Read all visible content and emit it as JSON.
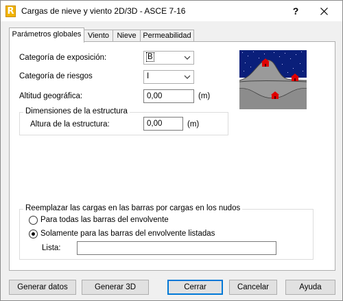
{
  "window": {
    "title": "Cargas de nieve y viento 2D/3D - ASCE 7-16",
    "help_label": "?"
  },
  "tabs": [
    {
      "label": "Parámetros globales",
      "active": true
    },
    {
      "label": "Viento",
      "active": false
    },
    {
      "label": "Nieve",
      "active": false
    },
    {
      "label": "Permeabilidad",
      "active": false
    }
  ],
  "form": {
    "exposure_label": "Categoría de exposición:",
    "exposure_value": "B",
    "risk_label": "Categoría de riesgos",
    "risk_value": "I",
    "altitude_label": "Altitud geográfica:",
    "altitude_value": "0,00",
    "altitude_unit": "(m)",
    "dimensions_group": "Dimensiones de la estructura",
    "height_label": "Altura de la estructura:",
    "height_value": "0,00",
    "height_unit": "(m)"
  },
  "replace_group": {
    "title": "Reemplazar las cargas en las barras por cargas en los nudos",
    "option_all": "Para todas las barras del envolvente",
    "option_listed": "Solamente para las barras del envolvente listadas",
    "selected": "option_listed",
    "list_label": "Lista:",
    "list_value": ""
  },
  "buttons": {
    "generate_data": "Generar datos",
    "generate_3d": "Generar 3D",
    "close": "Cerrar",
    "cancel": "Cancelar",
    "help": "Ayuda"
  },
  "colors": {
    "sky": "#0a1f7a",
    "house_red": "#e00000",
    "ground": "#8c8c8c",
    "default_button_border": "#0078d7"
  }
}
